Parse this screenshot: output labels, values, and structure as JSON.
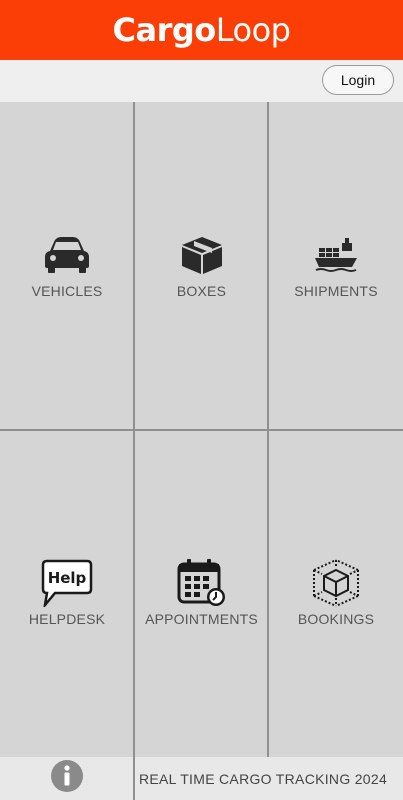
{
  "app": {
    "logo_primary": "Cargo",
    "logo_secondary": "Loop",
    "brand_color": "#fa3e06"
  },
  "toolbar": {
    "login_label": "Login"
  },
  "menu": [
    {
      "label": "VEHICLES",
      "icon": "car-icon"
    },
    {
      "label": "BOXES",
      "icon": "box-icon"
    },
    {
      "label": "SHIPMENTS",
      "icon": "cargo-ship-icon"
    },
    {
      "label": "HELPDESK",
      "icon": "help-bubble-icon"
    },
    {
      "label": "APPOINTMENTS",
      "icon": "calendar-clock-icon"
    },
    {
      "label": "BOOKINGS",
      "icon": "cube-network-icon"
    }
  ],
  "footer": {
    "info_icon": "info-icon",
    "tagline": "REAL TIME CARGO TRACKING 2024"
  }
}
